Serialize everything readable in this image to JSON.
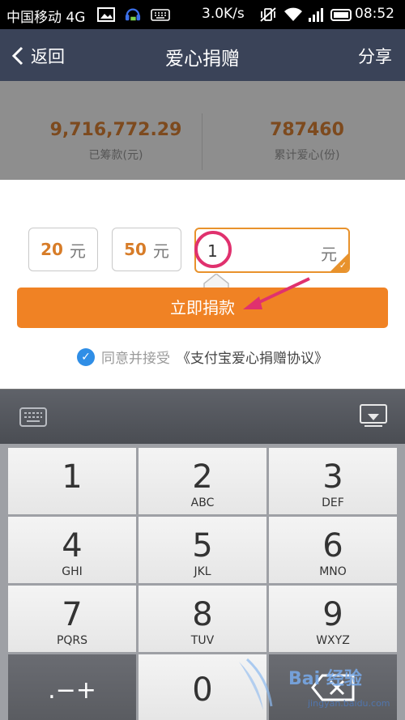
{
  "status_bar": {
    "carrier": "中国移动 4G",
    "speed": "3.0K/s",
    "time": "08:52"
  },
  "header": {
    "back_label": "返回",
    "title": "爱心捐赠",
    "share_label": "分享"
  },
  "stats": [
    {
      "value": "9,716,772.29",
      "label": "已筹款(元)"
    },
    {
      "value": "787460",
      "label": "累计爱心(份)"
    }
  ],
  "donation": {
    "options": [
      {
        "amount": "20",
        "unit": "元"
      },
      {
        "amount": "50",
        "unit": "元"
      }
    ],
    "custom_value": "1",
    "custom_unit": "元",
    "donate_label": "立即捐款",
    "agree_prefix": "同意并接受",
    "agree_link": "《支付宝爱心捐赠协议》"
  },
  "keypad": {
    "keys": [
      {
        "main": "1",
        "sub": ""
      },
      {
        "main": "2",
        "sub": "ABC"
      },
      {
        "main": "3",
        "sub": "DEF"
      },
      {
        "main": "4",
        "sub": "GHI"
      },
      {
        "main": "5",
        "sub": "JKL"
      },
      {
        "main": "6",
        "sub": "MNO"
      },
      {
        "main": "7",
        "sub": "PQRS"
      },
      {
        "main": "8",
        "sub": "TUV"
      },
      {
        "main": "9",
        "sub": "WXYZ"
      },
      {
        "main": ".−+",
        "sub": ""
      },
      {
        "main": "0",
        "sub": ""
      },
      {
        "main": "",
        "sub": ""
      }
    ]
  },
  "watermark": {
    "text": "Bai 经验",
    "sub": "jingyan.baidu.com"
  },
  "colors": {
    "header_bg": "#3a4358",
    "accent_orange": "#f08224",
    "stat_number": "#7d4a1e",
    "highlight_ring": "#e0316e",
    "checkbox_blue": "#2f8ee6"
  }
}
